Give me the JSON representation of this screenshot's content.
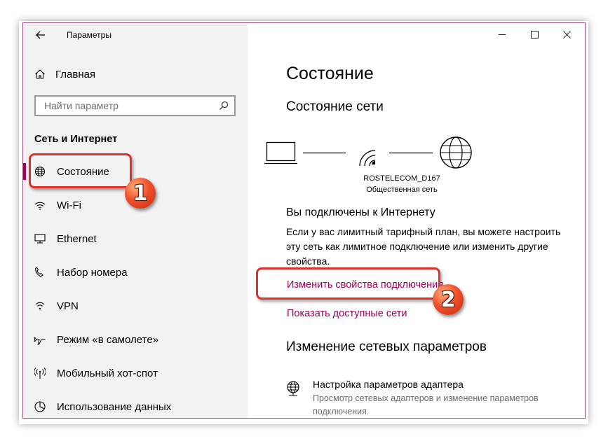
{
  "window": {
    "title": "Параметры",
    "back_icon": "arrow-left-icon",
    "controls": [
      "minimize-icon",
      "maximize-icon",
      "close-icon"
    ]
  },
  "sidebar": {
    "home_label": "Главная",
    "search_placeholder": "Найти параметр",
    "section_title": "Сеть и Интернет",
    "items": [
      {
        "label": "Состояние",
        "icon": "globe-icon",
        "active": true
      },
      {
        "label": "Wi-Fi",
        "icon": "wifi-icon"
      },
      {
        "label": "Ethernet",
        "icon": "ethernet-icon"
      },
      {
        "label": "Набор номера",
        "icon": "dialup-icon"
      },
      {
        "label": "VPN",
        "icon": "vpn-icon"
      },
      {
        "label": "Режим «в самолете»",
        "icon": "airplane-icon"
      },
      {
        "label": "Мобильный хот-спот",
        "icon": "hotspot-icon"
      },
      {
        "label": "Использование данных",
        "icon": "data-usage-icon"
      }
    ]
  },
  "main": {
    "title": "Состояние",
    "network_status_heading": "Состояние сети",
    "network_name": "ROSTELECOM_D167",
    "network_type": "Общественная сеть",
    "connected_text": "Вы подключены к Интернету",
    "description": "Если у вас лимитный тарифный план, вы можете настроить эту сеть как лимитное подключение или изменить другие свойства.",
    "link_change_properties": "Изменить свойства подключения",
    "link_show_networks": "Показать доступные сети",
    "change_settings_heading": "Изменение сетевых параметров",
    "adapter_title": "Настройка параметров адаптера",
    "adapter_desc": "Просмотр сетевых адаптеров и изменение параметров подключения."
  },
  "annotations": {
    "badge1": "1",
    "badge2": "2",
    "highlight_color": "#e0302c"
  },
  "colors": {
    "accent": "#a0005a",
    "sidebar_bg": "#f2f2f2"
  }
}
